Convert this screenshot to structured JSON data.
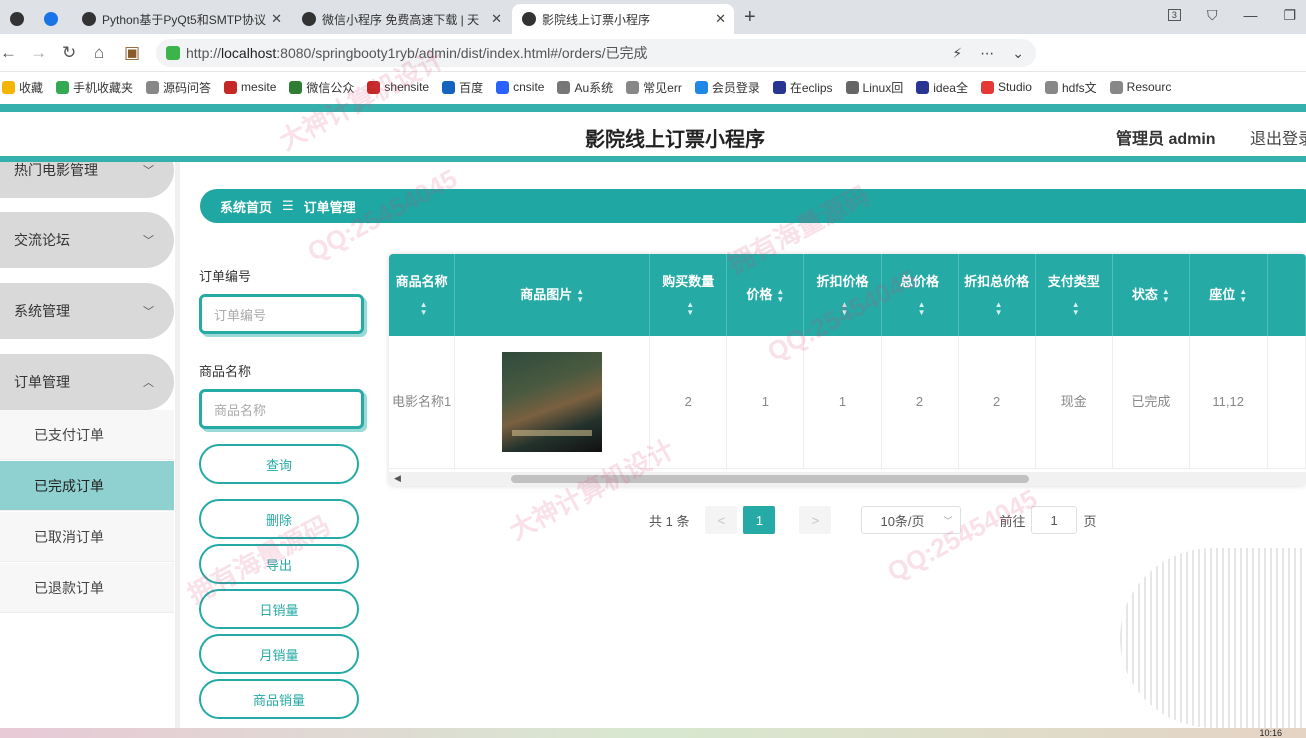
{
  "browser": {
    "tabs": [
      {
        "label": "Python基于PyQt5和SMTP协议"
      },
      {
        "label": "微信小程序 免费高速下载 | 天"
      },
      {
        "label": "影院线上订票小程序"
      }
    ],
    "tab_count_badge": "3",
    "url_prefix": "http://",
    "url_host": "localhost",
    "url_rest": ":8080/springbooty1ryb/admin/dist/index.html#/orders/已完成",
    "bookmarks": [
      "收藏",
      "手机收藏夹",
      "源码问答",
      "mesite",
      "微信公众",
      "shensite",
      "百度",
      "cnsite",
      "Au系统",
      "常见err",
      "会员登录",
      "在eclips",
      "Linux回",
      "idea全",
      "Studio",
      "hdfs文",
      "Resourc"
    ]
  },
  "header": {
    "title": "影院线上订票小程序",
    "admin_label": "管理员 admin",
    "logout_label": "退出登录"
  },
  "sidebar": {
    "menus": [
      {
        "label": "热门电影管理"
      },
      {
        "label": "交流论坛"
      },
      {
        "label": "系统管理"
      },
      {
        "label": "订单管理"
      }
    ],
    "submenu": [
      {
        "label": "已支付订单"
      },
      {
        "label": "已完成订单"
      },
      {
        "label": "已取消订单"
      },
      {
        "label": "已退款订单"
      }
    ]
  },
  "breadcrumb": {
    "home": "系统首页",
    "separator": "☰",
    "current": "订单管理"
  },
  "filters": {
    "order_no_label": "订单编号",
    "order_no_placeholder": "订单编号",
    "product_name_label": "商品名称",
    "product_name_placeholder": "商品名称"
  },
  "buttons": {
    "query": "查询",
    "delete": "删除",
    "export": "导出",
    "daily_sales": "日销量",
    "monthly_sales": "月销量",
    "product_sales": "商品销量"
  },
  "table": {
    "columns": [
      "商品名称",
      "商品图片",
      "购买数量",
      "价格",
      "折扣价格",
      "总价格",
      "折扣总价格",
      "支付类型",
      "状态",
      "座位"
    ],
    "rows": [
      {
        "name": "电影名称1",
        "quantity": "2",
        "price": "1",
        "discount_price": "1",
        "total": "2",
        "discount_total": "2",
        "pay_type": "现金",
        "status": "已完成",
        "seat": "11,12"
      }
    ]
  },
  "pagination": {
    "total": "共 1 条",
    "prev": "<",
    "page": "1",
    "next": ">",
    "page_size": "10条/页",
    "goto_prefix": "前往",
    "goto_value": "1",
    "goto_suffix": "页"
  },
  "taskbar": {
    "time": "10:16"
  },
  "watermarks": [
    "大神计算机设计",
    "QQ:25454045",
    "拥有海量源码",
    "QQ:25454045",
    "大神计算机设计",
    "拥有海量源码",
    "QQ:25454045"
  ],
  "colors": {
    "accent": "#26aaa5",
    "accent_light": "#8fd1d0"
  }
}
